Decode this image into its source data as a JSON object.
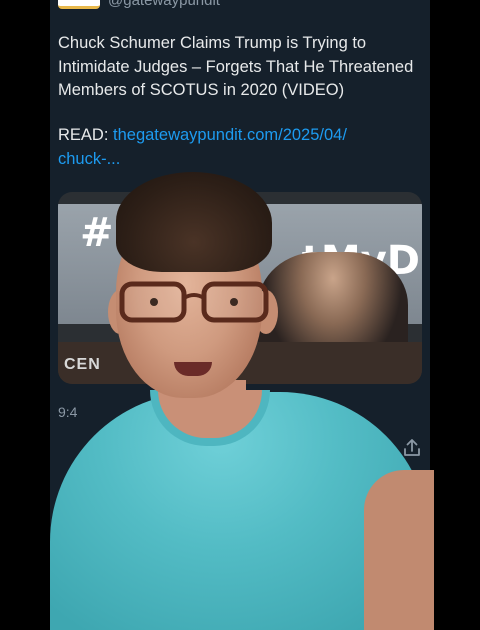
{
  "tweet": {
    "handle": "@gatewaypundit",
    "text": "Chuck Schumer Claims Trump is Trying to\nIntimidate Judges – Forgets That He Threatened\nMembers of SCOTUS in 2020 (VIDEO)",
    "read_prefix": "READ: ",
    "link_text": "thegatewaypundit.com/2025/04/\nchuck-...",
    "timestamp": "9:4"
  },
  "media": {
    "banner_left": "#",
    "banner_right": "tMyD",
    "lower_text": "CEN"
  },
  "icons": {
    "share": "share-icon",
    "notifications": "bell-icon",
    "messages": "mail-icon"
  },
  "colors": {
    "background": "#15202b",
    "text": "#e7e9ea",
    "link": "#1d9bf0",
    "muted": "#8b98a5"
  }
}
